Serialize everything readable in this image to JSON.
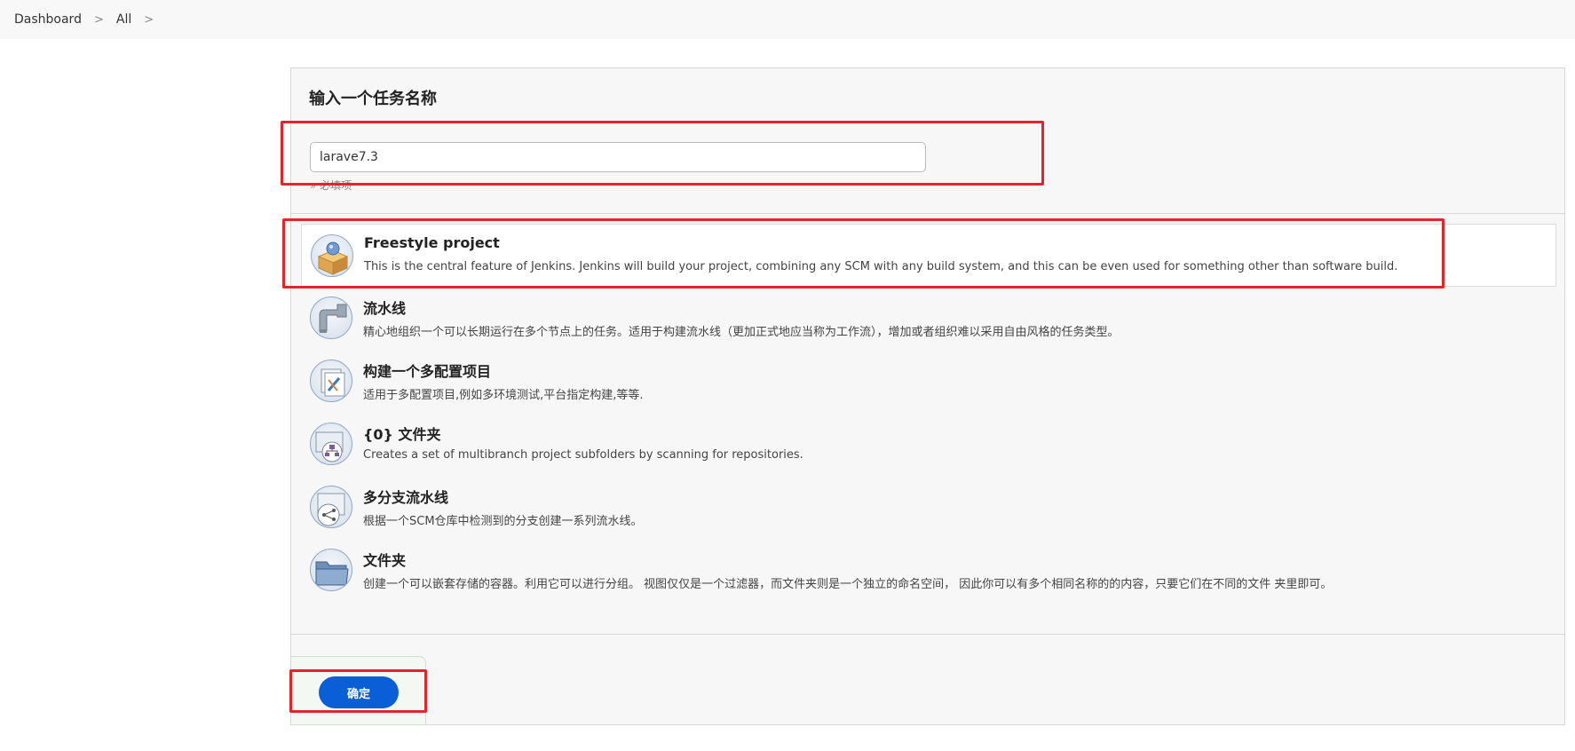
{
  "breadcrumb": {
    "items": [
      "Dashboard",
      "All"
    ],
    "separator": ">"
  },
  "form": {
    "title": "输入一个任务名称",
    "name_value": "larave7.3",
    "required_hint": "» 必填项"
  },
  "item_types": [
    {
      "name": "Freestyle project",
      "description": "This is the central feature of Jenkins. Jenkins will build your project, combining any SCM with any build system, and this can be even used for something other than software build.",
      "icon": "freestyle-project-icon",
      "selected": true
    },
    {
      "name": "流水线",
      "description": "精心地组织一个可以长期运行在多个节点上的任务。适用于构建流水线（更加正式地应当称为工作流），增加或者组织难以采用自由风格的任务类型。",
      "icon": "pipeline-icon",
      "selected": false
    },
    {
      "name": "构建一个多配置项目",
      "description": "适用于多配置项目,例如多环境测试,平台指定构建,等等.",
      "icon": "multi-config-icon",
      "selected": false
    },
    {
      "name": "{0} 文件夹",
      "description": "Creates a set of multibranch project subfolders by scanning for repositories.",
      "icon": "organization-folder-icon",
      "selected": false
    },
    {
      "name": "多分支流水线",
      "description": "根据一个SCM仓库中检测到的分支创建一系列流水线。",
      "icon": "multibranch-pipeline-icon",
      "selected": false
    },
    {
      "name": "文件夹",
      "description": "创建一个可以嵌套存储的容器。利用它可以进行分组。 视图仅仅是一个过滤器，而文件夹则是一个独立的命名空间， 因此你可以有多个相同名称的的内容，只要它们在不同的文件 夹里即可。",
      "icon": "folder-icon",
      "selected": false
    }
  ],
  "actions": {
    "ok_label": "确定"
  },
  "colors": {
    "highlight_box": "#e3242b",
    "primary_button": "#0b5fd6"
  }
}
